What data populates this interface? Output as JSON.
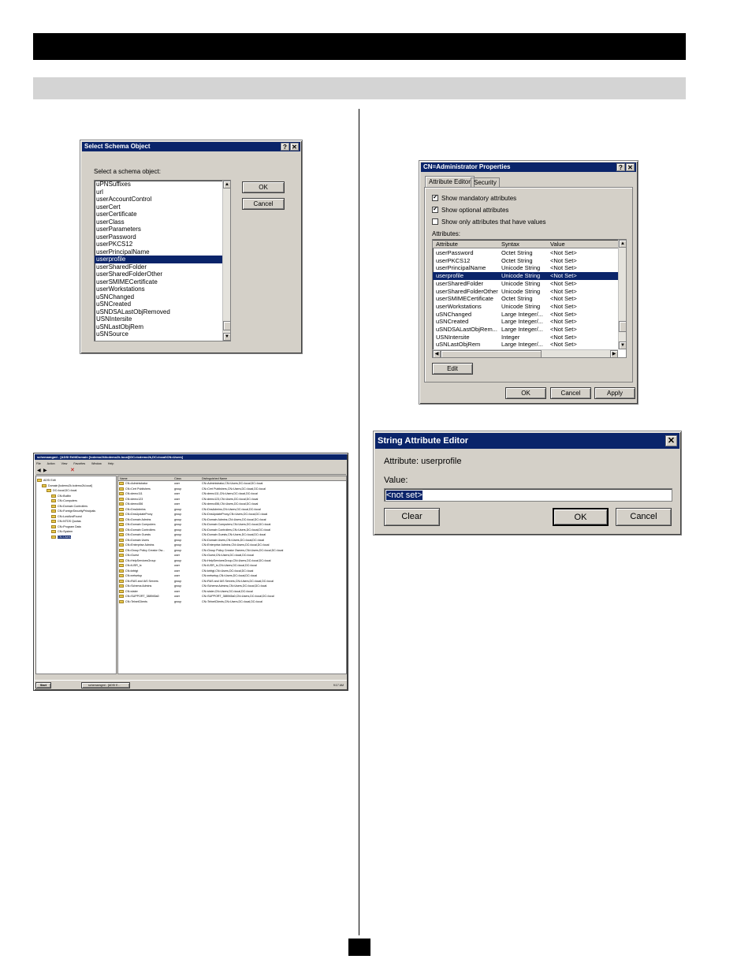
{
  "schema_dialog": {
    "title": "Select Schema Object",
    "prompt": "Select a schema object:",
    "ok": "OK",
    "cancel": "Cancel",
    "items": [
      "uPNSuffixes",
      "url",
      "userAccountControl",
      "userCert",
      "userCertificate",
      "userClass",
      "userParameters",
      "userPassword",
      "userPKCS12",
      "userPrincipalName",
      "userprofile",
      "userSharedFolder",
      "userSharedFolderOther",
      "userSMIMECertificate",
      "userWorkstations",
      "uSNChanged",
      "uSNCreated",
      "uSNDSALastObjRemoved",
      "USNIntersite",
      "uSNLastObjRem",
      "uSNSource"
    ],
    "selected": "userprofile"
  },
  "props_dialog": {
    "title": "CN=Administrator Properties",
    "tabs": [
      "Attribute Editor",
      "Security"
    ],
    "opt_mandatory": "Show mandatory attributes",
    "opt_optional": "Show optional attributes",
    "opt_values": "Show only attributes that have values",
    "attributes_label": "Attributes:",
    "columns": [
      "Attribute",
      "Syntax",
      "Value"
    ],
    "rows": [
      [
        "userPassword",
        "Octet String",
        "<Not Set>"
      ],
      [
        "userPKCS12",
        "Octet String",
        "<Not Set>"
      ],
      [
        "userPrincipalName",
        "Unicode String",
        "<Not Set>"
      ],
      [
        "userprofile",
        "Unicode String",
        "<Not Set>"
      ],
      [
        "userSharedFolder",
        "Unicode String",
        "<Not Set>"
      ],
      [
        "userSharedFolderOther",
        "Unicode String",
        "<Not Set>"
      ],
      [
        "userSMIMECertificate",
        "Octet String",
        "<Not Set>"
      ],
      [
        "userWorkstations",
        "Unicode String",
        "<Not Set>"
      ],
      [
        "uSNChanged",
        "Large Integer/...",
        "<Not Set>"
      ],
      [
        "uSNCreated",
        "Large Integer/...",
        "<Not Set>"
      ],
      [
        "uSNDSALastObjRem...",
        "Large Integer/...",
        "<Not Set>"
      ],
      [
        "USNIntersite",
        "Integer",
        "<Not Set>"
      ],
      [
        "uSNLastObjRem",
        "Large Integer/...",
        "<Not Set>"
      ]
    ],
    "selected_row": "userprofile",
    "edit": "Edit",
    "ok": "OK",
    "cancel": "Cancel",
    "apply": "Apply"
  },
  "string_editor": {
    "title": "String Attribute Editor",
    "attribute_label": "Attribute:",
    "attribute_value": "userprofile",
    "value_label": "Value:",
    "value": "<not set>",
    "clear": "Clear",
    "ok": "OK",
    "cancel": "Cancel"
  },
  "adsi": {
    "title": "schemamgmt - [ADSI Edit\\Domain [tcdemo2k\\tcdemo2k.local]\\DC=tcdemo2k,DC=local\\CN=Users]",
    "menu": [
      "File",
      "Action",
      "View",
      "Favorites",
      "Window",
      "Help"
    ],
    "tree": [
      "ADSI Edit",
      "Domain [tcdemo2k.tcdemo2k.local]",
      "DC=local,DC=local",
      "CN=Builtin",
      "CN=Computers",
      "CN=Domain Controllers",
      "CN=ForeignSecurityPrincipals",
      "CN=LostAndFound",
      "CN=NTDS Quotas",
      "CN=Program Data",
      "CN=System",
      "CN=Users"
    ],
    "columns": [
      "Name",
      "Class",
      "Distinguished Name"
    ],
    "rows": [
      [
        "CN=Administrator",
        "user",
        "CN=Administrator,CN=Users,DC=local,DC=local"
      ],
      [
        "CN=Cert Publishers",
        "group",
        "CN=Cert Publishers,CN=Users,DC=local,DC=local"
      ],
      [
        "CN=demo111",
        "user",
        "CN=demo111,CN=Users,DC=local,DC=local"
      ],
      [
        "CN=demo123",
        "user",
        "CN=demo123,CN=Users,DC=local,DC=local"
      ],
      [
        "CN=demo456",
        "user",
        "CN=demo456,CN=Users,DC=local,DC=local"
      ],
      [
        "CN=DnsAdmins",
        "group",
        "CN=DnsAdmins,CN=Users,DC=local,DC=local"
      ],
      [
        "CN=DnsUpdateProxy",
        "group",
        "CN=DnsUpdateProxy,CN=Users,DC=local,DC=local"
      ],
      [
        "CN=Domain Admins",
        "group",
        "CN=Domain Admins,CN=Users,DC=local,DC=local"
      ],
      [
        "CN=Domain Computers",
        "group",
        "CN=Domain Computers,CN=Users,DC=local,DC=local"
      ],
      [
        "CN=Domain Controllers",
        "group",
        "CN=Domain Controllers,CN=Users,DC=local,DC=local"
      ],
      [
        "CN=Domain Guests",
        "group",
        "CN=Domain Guests,CN=Users,DC=local,DC=local"
      ],
      [
        "CN=Domain Users",
        "group",
        "CN=Domain Users,CN=Users,DC=local,DC=local"
      ],
      [
        "CN=Enterprise Admins",
        "group",
        "CN=Enterprise Admins,CN=Users,DC=local,DC=local"
      ],
      [
        "CN=Group Policy Creator Ow...",
        "group",
        "CN=Group Policy Creator Owners,CN=Users,DC=local,DC=local"
      ],
      [
        "CN=Guest",
        "user",
        "CN=Guest,CN=Users,DC=local,DC=local"
      ],
      [
        "CN=HelpServicesGroup",
        "group",
        "CN=HelpServicesGroup,CN=Users,DC=local,DC=local"
      ],
      [
        "CN=IUSR_tc",
        "user",
        "CN=IUSR_tc,CN=Users,DC=local,DC=local"
      ],
      [
        "CN=krbtgt",
        "user",
        "CN=krbtgt,CN=Users,DC=local,DC=local"
      ],
      [
        "CN=netsetup",
        "user",
        "CN=netsetup,CN=Users,DC=local,DC=local"
      ],
      [
        "CN=RAS and IAS Servers",
        "group",
        "CN=RAS and IAS Servers,CN=Users,DC=local,DC=local"
      ],
      [
        "CN=Schema Admins",
        "group",
        "CN=Schema Admins,CN=Users,DC=local,DC=local"
      ],
      [
        "CN=sister",
        "user",
        "CN=sister,CN=Users,DC=local,DC=local"
      ],
      [
        "CN=SUPPORT_388945a0",
        "user",
        "CN=SUPPORT_388945a0,CN=Users,DC=local,DC=local"
      ],
      [
        "CN=TelnetClients",
        "group",
        "CN=TelnetClients,CN=Users,DC=local,DC=local"
      ]
    ],
    "start": "Start",
    "task": "schemamgmt - [ADSI E...",
    "clock": "9:17 AM"
  }
}
